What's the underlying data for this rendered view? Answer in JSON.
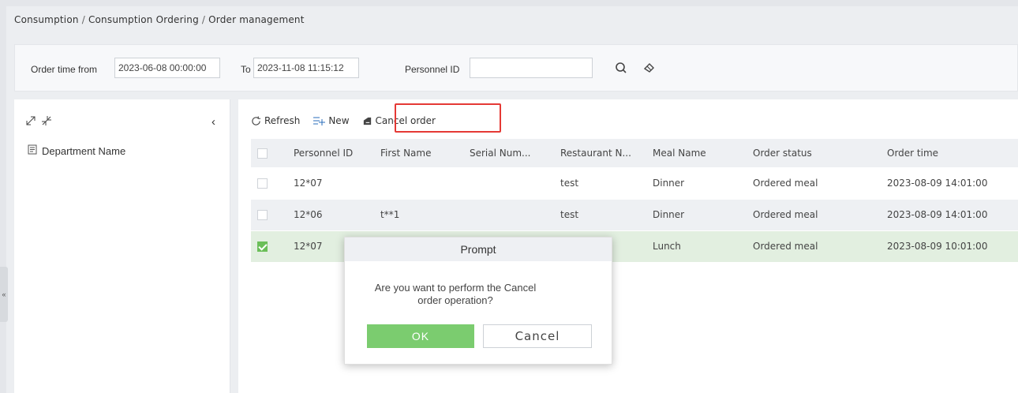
{
  "breadcrumb": {
    "items": [
      "Consumption",
      "Consumption Ordering",
      "Order management"
    ],
    "separator": "/"
  },
  "filters": {
    "order_time_from_label": "Order time from",
    "order_time_from_value": "2023-06-08 00:00:00",
    "to_label": "To",
    "to_value": "2023-11-08 11:15:12",
    "personnel_id_label": "Personnel ID",
    "personnel_id_value": "",
    "search_icon": "search-icon",
    "clear_icon": "eraser-icon"
  },
  "left_panel": {
    "expand_icon": "expand-all-icon",
    "collapse_icon": "collapse-all-icon",
    "collapse_arrow": "‹",
    "tree_root_label": "Department Name",
    "side_handle": "«"
  },
  "toolbar": {
    "refresh_label": "Refresh",
    "new_label": "New",
    "cancel_order_label": "Cancel order",
    "highlight_color": "#e53935"
  },
  "table": {
    "columns": [
      "Personnel ID",
      "First Name",
      "Serial Num...",
      "Restaurant N...",
      "Meal Name",
      "Order status",
      "Order time"
    ],
    "rows": [
      {
        "checked": false,
        "personnel_id": "12*07",
        "first_name": "",
        "serial_num": "",
        "restaurant": "test",
        "meal": "Dinner",
        "status": "Ordered meal",
        "time": "2023-08-09 14:01:00"
      },
      {
        "checked": false,
        "personnel_id": "12*06",
        "first_name": "t**1",
        "serial_num": "",
        "restaurant": "test",
        "meal": "Dinner",
        "status": "Ordered meal",
        "time": "2023-08-09 14:01:00"
      },
      {
        "checked": true,
        "personnel_id": "12*07",
        "first_name": "",
        "serial_num": "",
        "restaurant": "",
        "meal": "Lunch",
        "status": "Ordered meal",
        "time": "2023-08-09 10:01:00"
      }
    ]
  },
  "modal": {
    "title": "Prompt",
    "message": "Are you want to perform the Cancel order operation?",
    "ok_label": "OK",
    "cancel_label": "Cancel",
    "ok_color": "#7bcc6f"
  }
}
